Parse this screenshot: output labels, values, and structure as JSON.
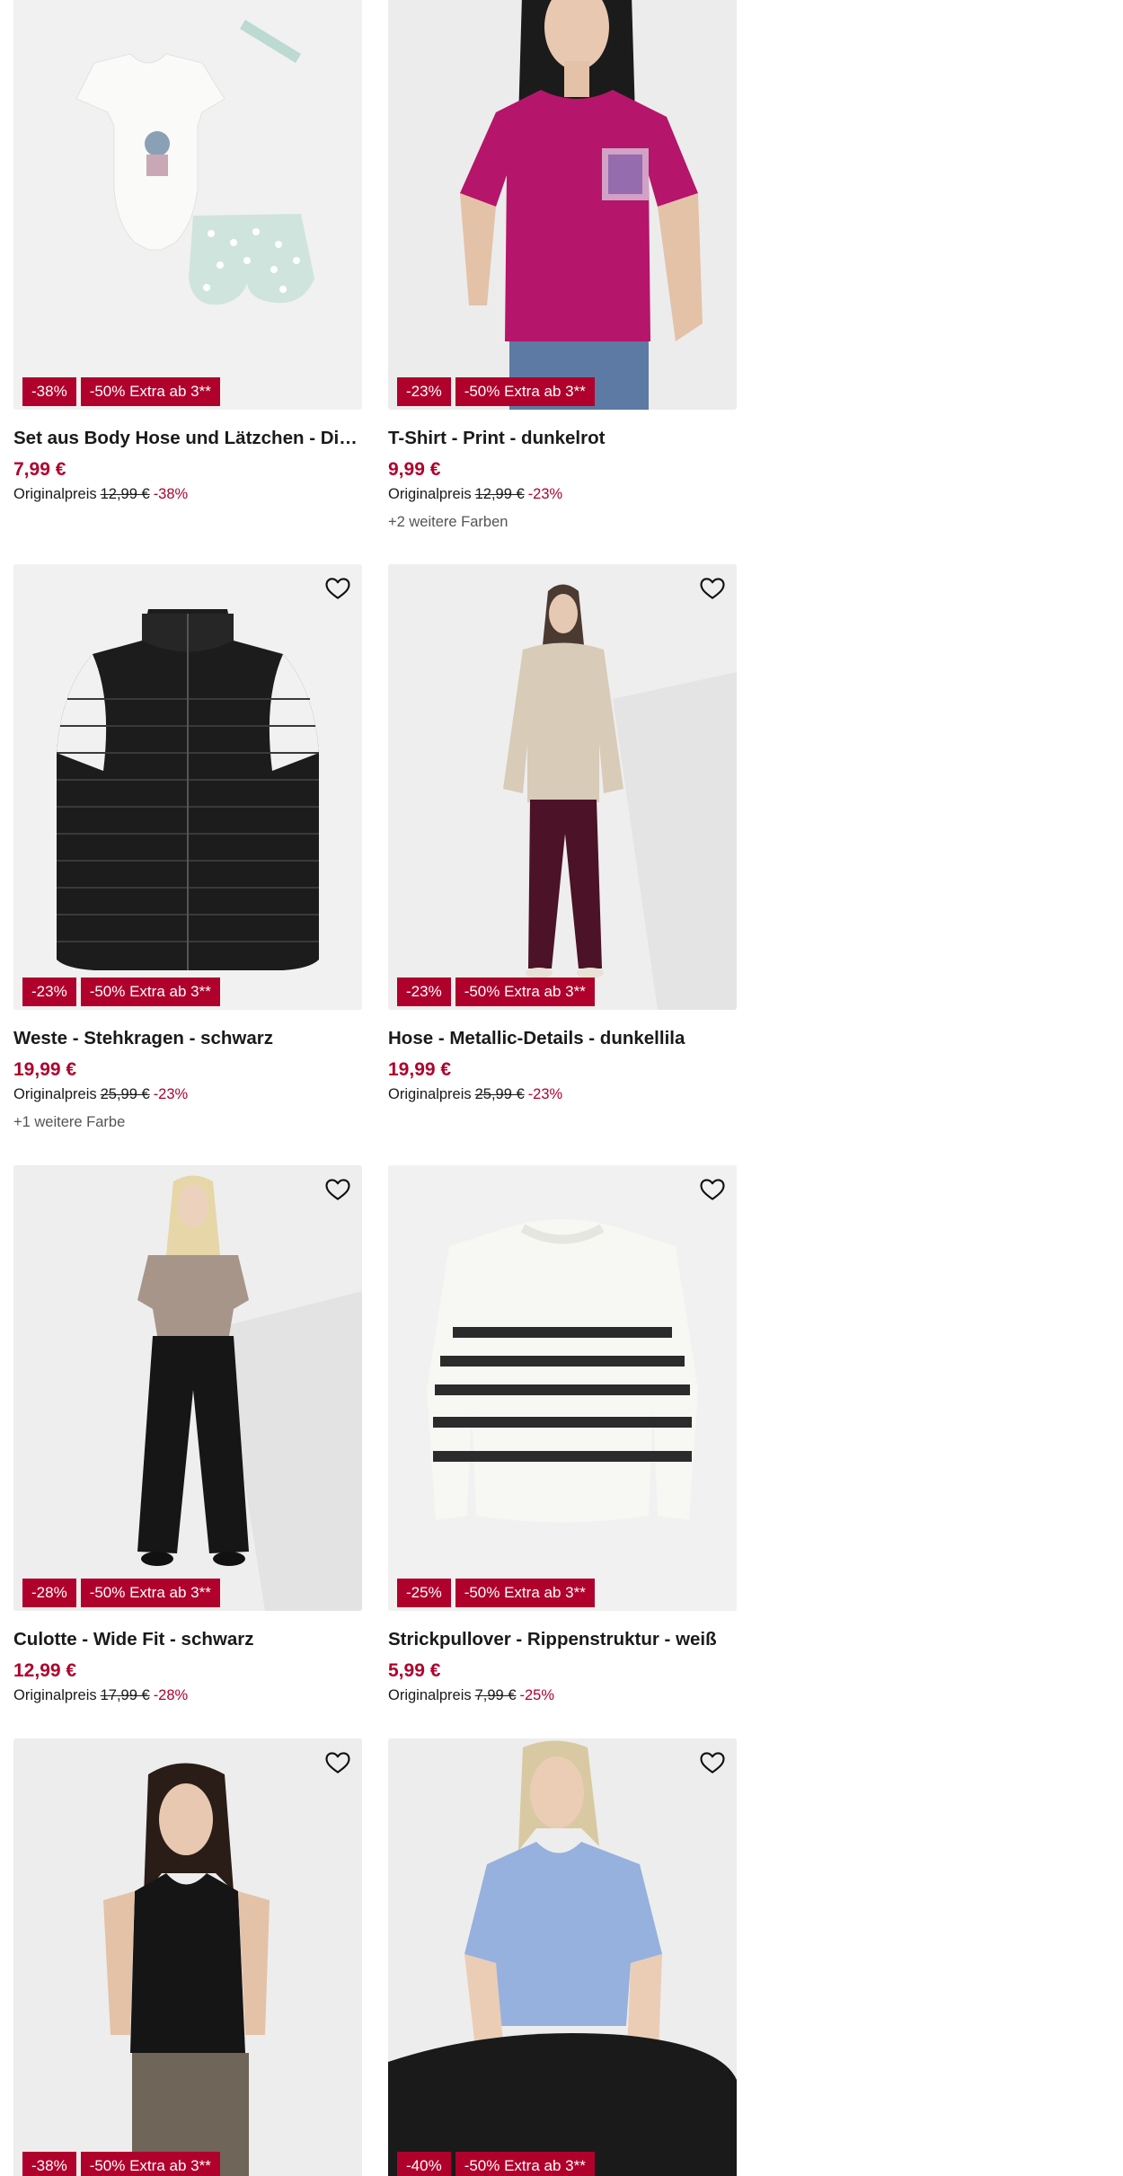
{
  "wishlist_icon": "heart-outline-icon",
  "colors": {
    "sale": "#b0002c",
    "text": "#1a1a1a",
    "muted": "#555555",
    "image_bg": "#f2f2f2"
  },
  "products": [
    {
      "name": "Set aus Body Hose und Lätzchen - Disne...",
      "price": "7,99 €",
      "orig_label": "Originalpreis",
      "orig_price": "12,99 €",
      "orig_pct": "-38%",
      "badge_discount": "-38%",
      "badge_extra": "-50% Extra ab 3**",
      "more_colors": "",
      "image": "baby-set-image"
    },
    {
      "name": "T-Shirt - Print - dunkelrot",
      "price": "9,99 €",
      "orig_label": "Originalpreis",
      "orig_price": "12,99 €",
      "orig_pct": "-23%",
      "badge_discount": "-23%",
      "badge_extra": "-50% Extra ab 3**",
      "more_colors": "+2 weitere Farben",
      "image": "tshirt-model-image"
    },
    {
      "name": "Weste - Stehkragen - schwarz",
      "price": "19,99 €",
      "orig_label": "Originalpreis",
      "orig_price": "25,99 €",
      "orig_pct": "-23%",
      "badge_discount": "-23%",
      "badge_extra": "-50% Extra ab 3**",
      "more_colors": "+1 weitere Farbe",
      "image": "vest-image"
    },
    {
      "name": "Hose - Metallic-Details - dunkellila",
      "price": "19,99 €",
      "orig_label": "Originalpreis",
      "orig_price": "25,99 €",
      "orig_pct": "-23%",
      "badge_discount": "-23%",
      "badge_extra": "-50% Extra ab 3**",
      "more_colors": "",
      "image": "trousers-model-image"
    },
    {
      "name": "Culotte - Wide Fit - schwarz",
      "price": "12,99 €",
      "orig_label": "Originalpreis",
      "orig_price": "17,99 €",
      "orig_pct": "-28%",
      "badge_discount": "-28%",
      "badge_extra": "-50% Extra ab 3**",
      "more_colors": "",
      "image": "culotte-model-image"
    },
    {
      "name": "Strickpullover - Rippenstruktur - weiß",
      "price": "5,99 €",
      "orig_label": "Originalpreis",
      "orig_price": "7,99 €",
      "orig_pct": "-25%",
      "badge_discount": "-25%",
      "badge_extra": "-50% Extra ab 3**",
      "more_colors": "",
      "image": "striped-sweater-image"
    },
    {
      "name": "",
      "price": "",
      "orig_label": "",
      "orig_price": "",
      "orig_pct": "",
      "badge_discount": "-38%",
      "badge_extra": "-50% Extra ab 3**",
      "more_colors": "",
      "image": "black-blouse-model-image"
    },
    {
      "name": "",
      "price": "",
      "orig_label": "",
      "orig_price": "",
      "orig_pct": "",
      "badge_discount": "-40%",
      "badge_extra": "-50% Extra ab 3**",
      "more_colors": "",
      "image": "blue-polo-model-image"
    }
  ]
}
